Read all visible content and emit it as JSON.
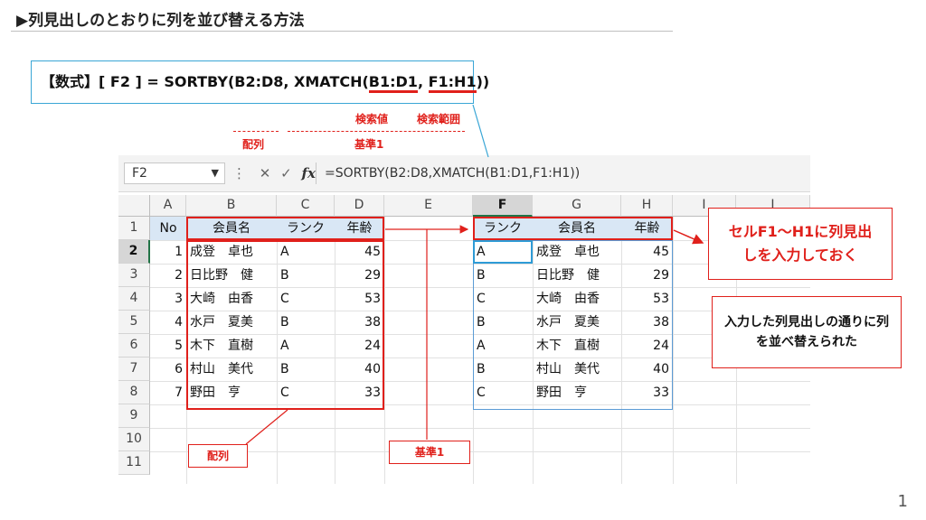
{
  "title": "▶列見出しのとおりに列を並び替える方法",
  "formula": {
    "prefix": "【数式】",
    "cellref": "[ F2 ] = SORTBY(B2:D8, XMATCH(",
    "arg1": "B1:D1",
    "sep": ", ",
    "arg2": "F1:H1",
    "suffix": "))"
  },
  "labels": {
    "search_value": "検索値",
    "search_range": "検索範囲",
    "array": "配列",
    "basis": "基準1"
  },
  "excel": {
    "name_box": "F2",
    "fx": "fx",
    "formula_text": "=SORTBY(B2:D8,XMATCH(B1:D1,F1:H1))",
    "columns": [
      "A",
      "B",
      "C",
      "D",
      "E",
      "F",
      "G",
      "H",
      "I",
      "J"
    ],
    "rows": [
      "1",
      "2",
      "3",
      "4",
      "5",
      "6",
      "7",
      "8",
      "9",
      "10",
      "11"
    ],
    "header_left": [
      "No",
      "会員名",
      "ランク",
      "年齢"
    ],
    "header_right": [
      "ランク",
      "会員名",
      "年齢"
    ],
    "data_left": [
      [
        "1",
        "成登　卓也",
        "A",
        "45"
      ],
      [
        "2",
        "日比野　健",
        "B",
        "29"
      ],
      [
        "3",
        "大崎　由香",
        "C",
        "53"
      ],
      [
        "4",
        "水戸　夏美",
        "B",
        "38"
      ],
      [
        "5",
        "木下　直樹",
        "A",
        "24"
      ],
      [
        "6",
        "村山　美代",
        "B",
        "40"
      ],
      [
        "7",
        "野田　亨",
        "C",
        "33"
      ]
    ],
    "data_right": [
      [
        "A",
        "成登　卓也",
        "45"
      ],
      [
        "B",
        "日比野　健",
        "29"
      ],
      [
        "C",
        "大崎　由香",
        "53"
      ],
      [
        "B",
        "水戸　夏美",
        "38"
      ],
      [
        "A",
        "木下　直樹",
        "24"
      ],
      [
        "B",
        "村山　美代",
        "40"
      ],
      [
        "C",
        "野田　亨",
        "33"
      ]
    ]
  },
  "callouts": {
    "input_headers": "セルF1～H1に列見出しを入力しておく",
    "result": "入力した列見出しの通りに列を並べ替えられた"
  },
  "page_number": "1"
}
